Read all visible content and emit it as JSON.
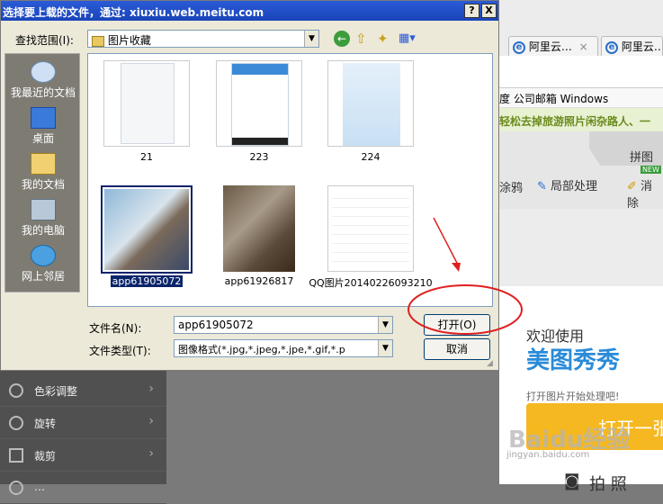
{
  "dialog": {
    "title": "选择要上载的文件，通过: xiuxiu.web.meitu.com",
    "help_btn": "?",
    "close_btn": "X",
    "lookin_label": "查找范围(I):",
    "lookin_value": "图片收藏",
    "places": [
      {
        "label": "我最近的文档",
        "icon": "recent-documents-icon"
      },
      {
        "label": "桌面",
        "icon": "desktop-icon"
      },
      {
        "label": "我的文档",
        "icon": "my-documents-icon"
      },
      {
        "label": "我的电脑",
        "icon": "my-computer-icon"
      },
      {
        "label": "网上邻居",
        "icon": "network-places-icon"
      }
    ],
    "files": [
      {
        "name": "21"
      },
      {
        "name": "223"
      },
      {
        "name": "224"
      },
      {
        "name": "app61905072"
      },
      {
        "name": "app61926817"
      },
      {
        "name": "QQ图片20140226093210"
      }
    ],
    "filename_label": "文件名(N):",
    "filename_value": "app61905072",
    "filetype_label": "文件类型(T):",
    "filetype_value": "图像格式(*.jpg,*.jpeg,*.jpe,*.gif,*.p",
    "open_btn": "打开(O)",
    "cancel_btn": "取消"
  },
  "browser": {
    "tabs": [
      "阿里云…",
      "阿里云…"
    ],
    "bookmarks": "度  公司邮箱  Windows",
    "banner": "轻松去掉旅游照片闲杂路人、一",
    "tool_pintu": "拼图",
    "tool_items": [
      "涂鸦",
      "局部处理",
      "消除"
    ],
    "new_badge": "NEW"
  },
  "meitu": {
    "welcome": "欢迎使用",
    "brand": "美图秀秀",
    "hint": "打开图片开始处理吧!",
    "open_one": "打开一张",
    "camera": "拍  照",
    "watermark": "Baidu经验",
    "watermark_url": "jingyan.baidu.com"
  },
  "left_menu": {
    "items": [
      "色彩调整",
      "旋转",
      "裁剪",
      "…"
    ]
  },
  "colors": {
    "accent_red": "#e02020",
    "titlebar": "#2a5bd7",
    "open_yellow": "#f5b820"
  }
}
